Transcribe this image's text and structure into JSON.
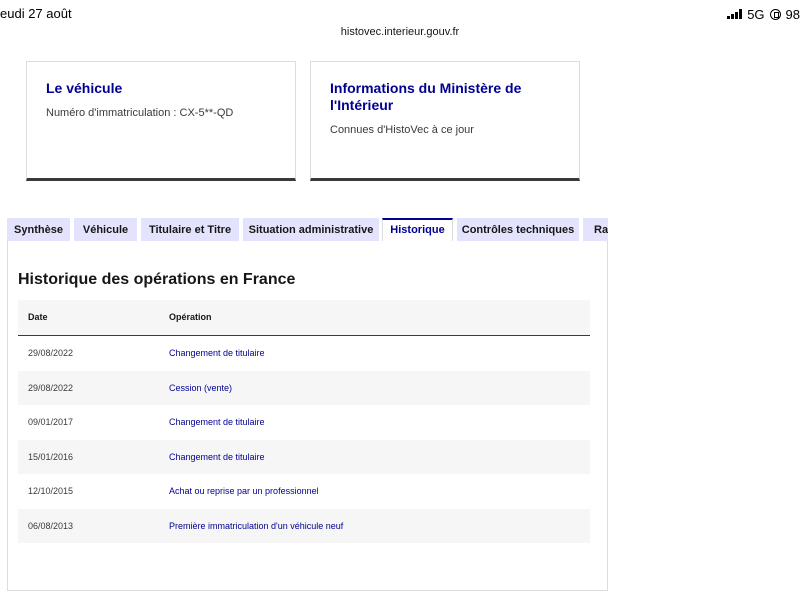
{
  "status_bar": {
    "time": "eudi 27 août",
    "network": "5G",
    "battery": "98"
  },
  "browser": {
    "url": "histovec.interieur.gouv.fr"
  },
  "cards": [
    {
      "title": "Le véhicule",
      "description": "Numéro d'immatriculation : CX-5**-QD"
    },
    {
      "title": "Informations du Ministère de l'Intérieur",
      "description": "Connues d'HistoVec à ce jour"
    }
  ],
  "tabs": [
    {
      "label": "Synthèse",
      "active": false
    },
    {
      "label": "Véhicule",
      "active": false
    },
    {
      "label": "Titulaire et Titre",
      "active": false
    },
    {
      "label": "Situation administrative",
      "active": false
    },
    {
      "label": "Historique",
      "active": true
    },
    {
      "label": "Contrôles techniques",
      "active": false
    },
    {
      "label": "Rap",
      "active": false
    }
  ],
  "history": {
    "title": "Historique des opérations en France",
    "columns": [
      "Date",
      "Opération"
    ],
    "rows": [
      {
        "date": "29/08/2022",
        "operation": "Changement de titulaire"
      },
      {
        "date": "29/08/2022",
        "operation": "Cession (vente)"
      },
      {
        "date": "09/01/2017",
        "operation": "Changement de titulaire"
      },
      {
        "date": "15/01/2016",
        "operation": "Changement de titulaire"
      },
      {
        "date": "12/10/2015",
        "operation": "Achat ou reprise par un professionnel"
      },
      {
        "date": "06/08/2013",
        "operation": "Première immatriculation d'un véhicule neuf"
      }
    ]
  },
  "colors": {
    "accent": "#000091",
    "tab_bg": "#e3e3fd",
    "row_alt": "#f6f6f6"
  }
}
